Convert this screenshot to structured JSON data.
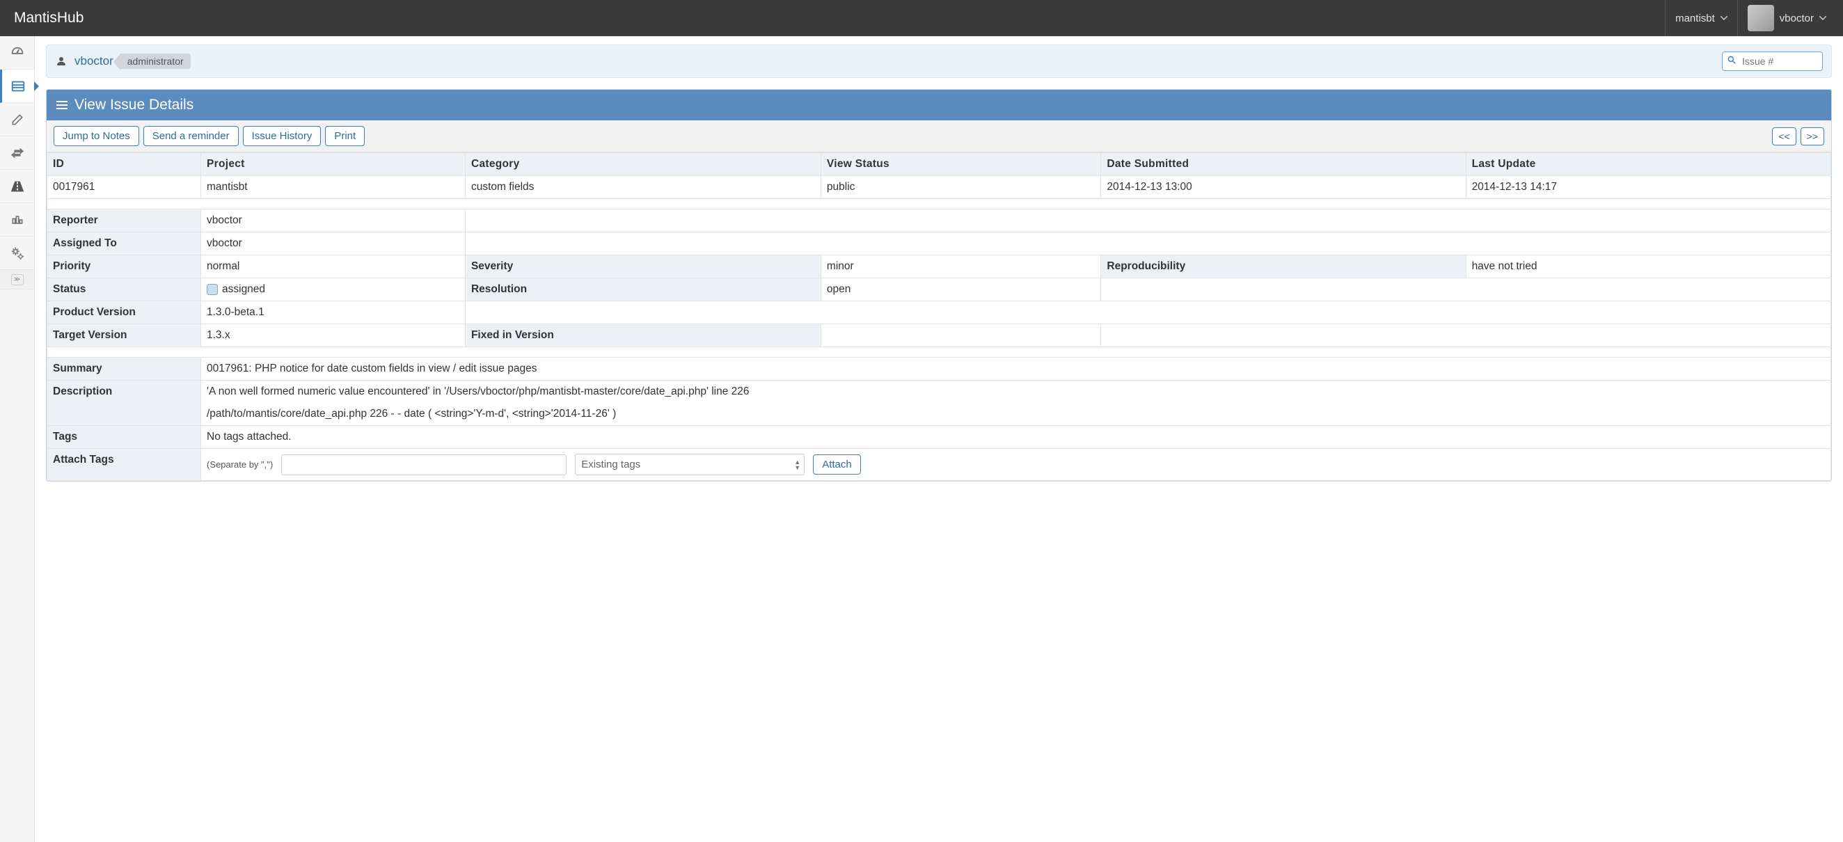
{
  "app": {
    "brand": "MantisHub"
  },
  "nav": {
    "project": "mantisbt",
    "user": "vboctor"
  },
  "breadcrumb": {
    "user": "vboctor",
    "role": "administrator",
    "search_placeholder": "Issue #"
  },
  "panel": {
    "title": "View Issue Details",
    "buttons": {
      "jump": "Jump to Notes",
      "reminder": "Send a reminder",
      "history": "Issue History",
      "print": "Print",
      "prev": "<<",
      "next": ">>"
    }
  },
  "headers": {
    "id": "ID",
    "project": "Project",
    "category": "Category",
    "view_status": "View Status",
    "date_submitted": "Date Submitted",
    "last_update": "Last Update"
  },
  "issue": {
    "id": "0017961",
    "project": "mantisbt",
    "category": "custom fields",
    "view_status": "public",
    "date_submitted": "2014-12-13 13:00",
    "last_update": "2014-12-13 14:17"
  },
  "labels": {
    "reporter": "Reporter",
    "assigned_to": "Assigned To",
    "priority": "Priority",
    "severity": "Severity",
    "reproducibility": "Reproducibility",
    "status": "Status",
    "resolution": "Resolution",
    "product_version": "Product Version",
    "target_version": "Target Version",
    "fixed_in_version": "Fixed in Version",
    "summary": "Summary",
    "description": "Description",
    "tags": "Tags",
    "attach_tags": "Attach Tags"
  },
  "values": {
    "reporter": "vboctor",
    "assigned_to": "vboctor",
    "priority": "normal",
    "severity": "minor",
    "reproducibility": "have not tried",
    "status": "assigned",
    "resolution": "open",
    "product_version": "1.3.0-beta.1",
    "target_version": "1.3.x",
    "fixed_in_version": "",
    "summary": "0017961: PHP notice for date custom fields in view / edit issue pages",
    "description_line1": "'A non well formed numeric value encountered' in '/Users/vboctor/php/mantisbt-master/core/date_api.php' line 226",
    "description_line2": "/path/to/mantis/core/date_api.php 226 - - date ( <string>'Y-m-d', <string>'2014-11-26' )",
    "tags": "No tags attached."
  },
  "attach": {
    "hint": "(Separate by \",\")",
    "select_placeholder": "Existing tags",
    "button": "Attach"
  },
  "colors": {
    "accent": "#3f7fbf",
    "panel_header": "#5c8cbf",
    "navbar": "#3a3a3a"
  }
}
